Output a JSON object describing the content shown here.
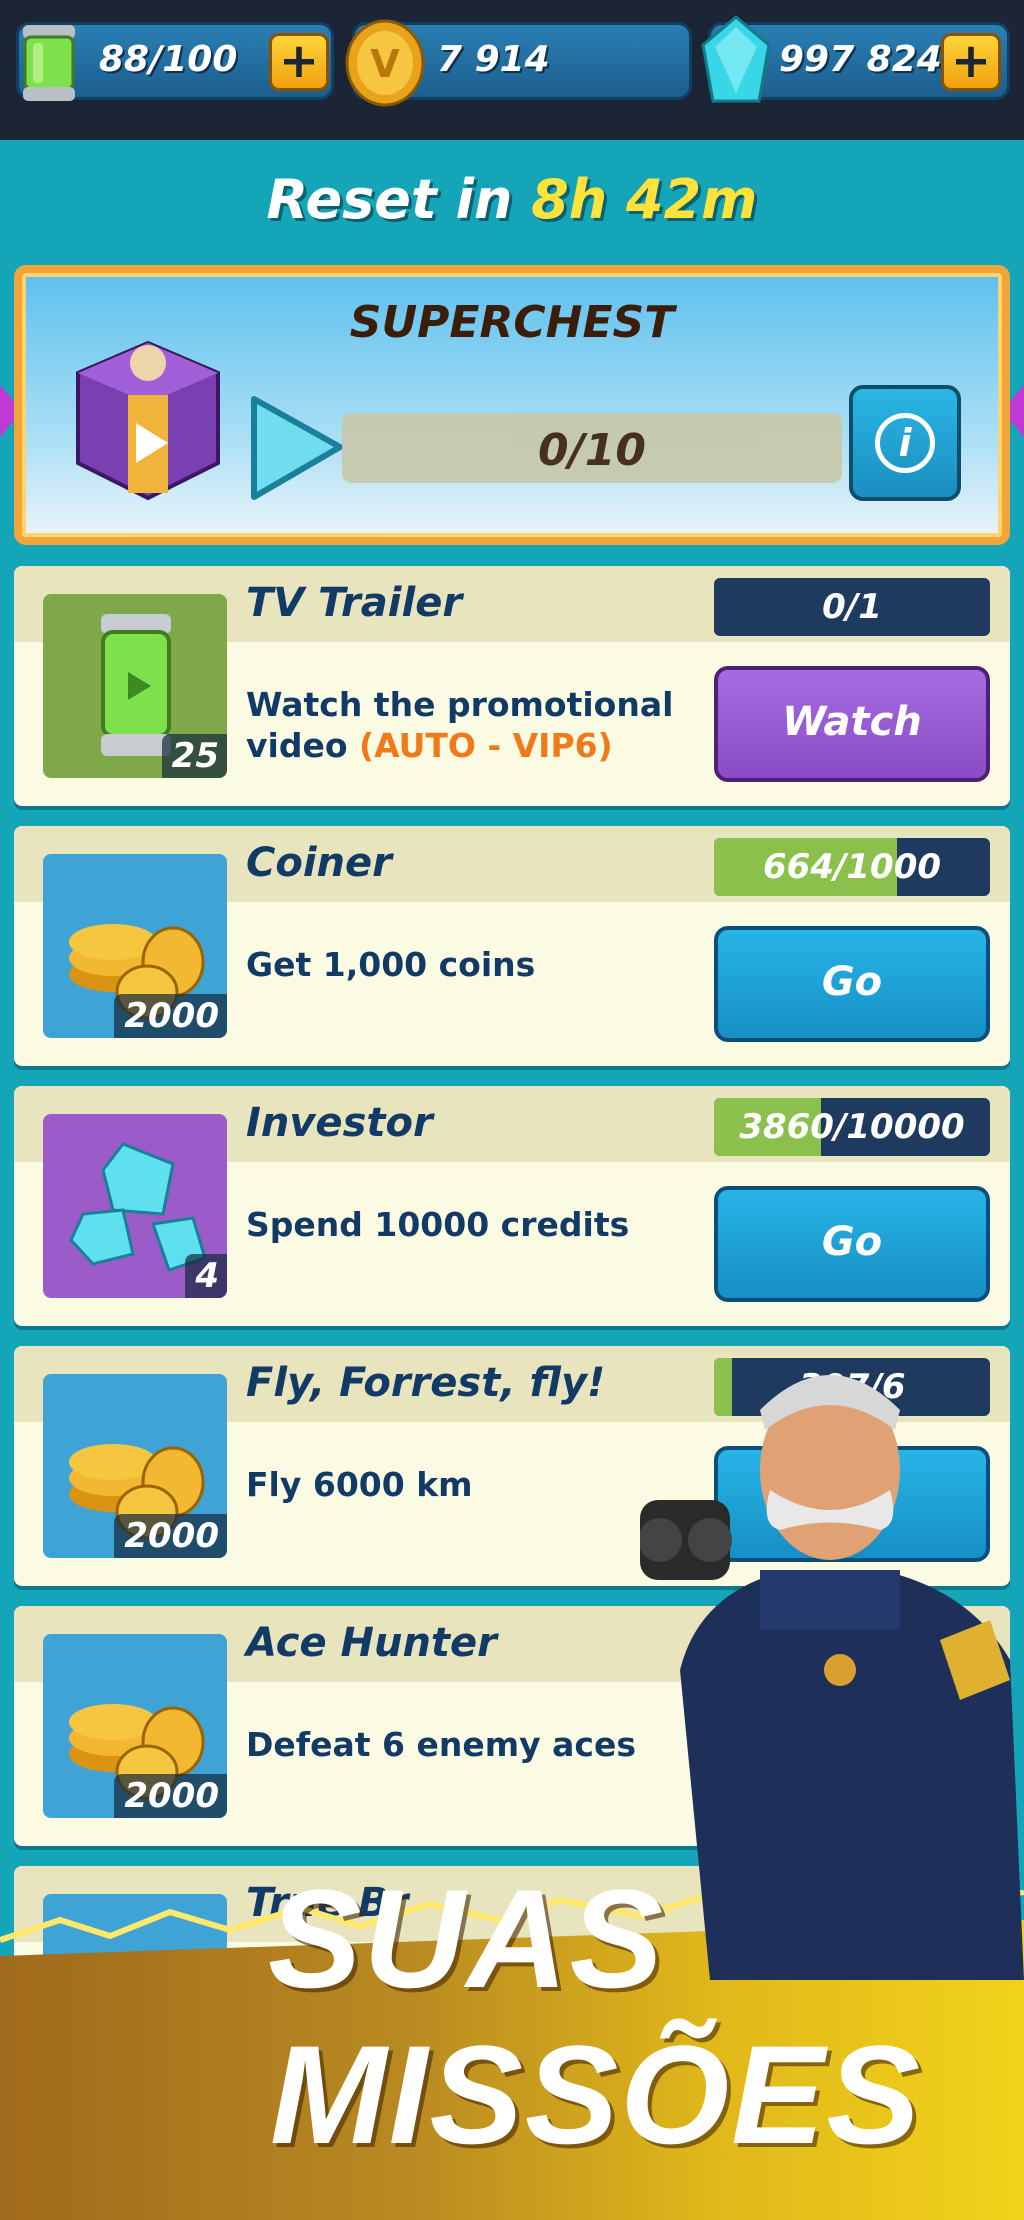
{
  "resources": {
    "energy": {
      "value": "88/100",
      "icon": "energy-canister-icon",
      "plus": "+"
    },
    "coins": {
      "value": "7 914",
      "icon": "coin-icon",
      "plus": ""
    },
    "gems": {
      "value": "997 824",
      "icon": "gem-icon",
      "plus": "+"
    }
  },
  "reset": {
    "label": "Reset in",
    "time": "8h 42m"
  },
  "superchest": {
    "title": "SUPERCHEST",
    "progress": "0/10",
    "progress_fraction": 0.0,
    "info_label": "i"
  },
  "missions": [
    {
      "title": "TV Trailer",
      "description": "Watch the promotional video",
      "highlight": "(AUTO - VIP6)",
      "progress": "0/1",
      "progress_fraction": 0.0,
      "button": "Watch",
      "reward_count": "25",
      "icon": "energy-canister-icon"
    },
    {
      "title": "Coiner",
      "description": "Get 1,000 coins",
      "highlight": "",
      "progress": "664/1000",
      "progress_fraction": 0.664,
      "button": "Go",
      "reward_count": "2000",
      "icon": "coins-stack-icon"
    },
    {
      "title": "Investor",
      "description": "Spend 10000 credits",
      "highlight": "",
      "progress": "3860/10000",
      "progress_fraction": 0.386,
      "button": "Go",
      "reward_count": "4",
      "icon": "gems-pile-icon"
    },
    {
      "title": "Fly, Forrest, fly!",
      "description": "Fly 6000 km",
      "highlight": "",
      "progress": "397/6",
      "progress_fraction": 0.066,
      "button": "G",
      "reward_count": "2000",
      "icon": "coins-stack-icon"
    },
    {
      "title": "Ace Hunter",
      "description": "Defeat 6 enemy aces",
      "highlight": "",
      "progress": "",
      "progress_fraction": 0.0,
      "button": "",
      "reward_count": "2000",
      "icon": "coins-stack-icon"
    },
    {
      "title": "True Br",
      "description": "",
      "highlight": "",
      "progress": "",
      "progress_fraction": 0.0,
      "button": "",
      "reward_count": "",
      "icon": "boot-icon"
    }
  ],
  "banner": {
    "line1": "SUAS",
    "line2": "MISSÕES"
  },
  "colors": {
    "background": "#14a6b8",
    "topbar": "#1b2535",
    "text_dark": "#123a66",
    "progress_fill": "#8cc04c",
    "go_button": "#1fa3d8",
    "watch_button": "#9a5cd6"
  }
}
